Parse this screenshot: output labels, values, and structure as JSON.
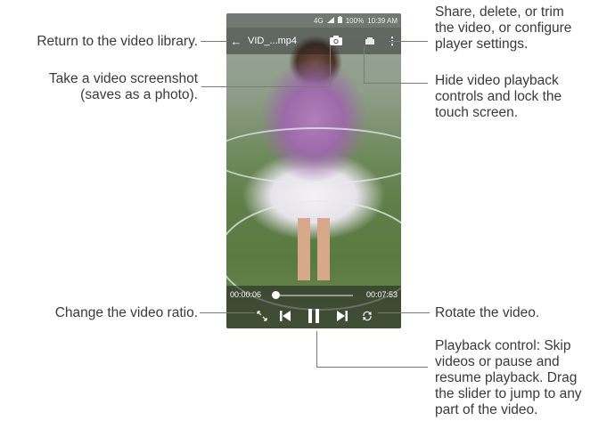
{
  "status_bar": {
    "network": "4G",
    "battery": "100%",
    "time": "10:39 AM"
  },
  "top_bar": {
    "back_icon": "back-arrow-icon",
    "title": "VID_...mp4"
  },
  "playback": {
    "elapsed": "00:00:06",
    "duration": "00:07:53",
    "progress_fraction": 0.013
  },
  "annotations": {
    "back": "Return to the video library.",
    "screenshot": "Take a video screenshot\n(saves as a photo).",
    "menu": "Share, delete, or trim\nthe video, or configure\nplayer settings.",
    "lock": "Hide video playback\ncontrols and lock the\ntouch screen.",
    "ratio": "Change the video ratio.",
    "rotate": "Rotate the video.",
    "playback": "Playback control: Skip\nvideos or pause and\nresume playback. Drag\nthe slider to jump to any\npart of the video."
  },
  "colors": {
    "text": "#3a3a3a",
    "leader": "#7a7a7a",
    "overlay": "#1e1e1e"
  }
}
